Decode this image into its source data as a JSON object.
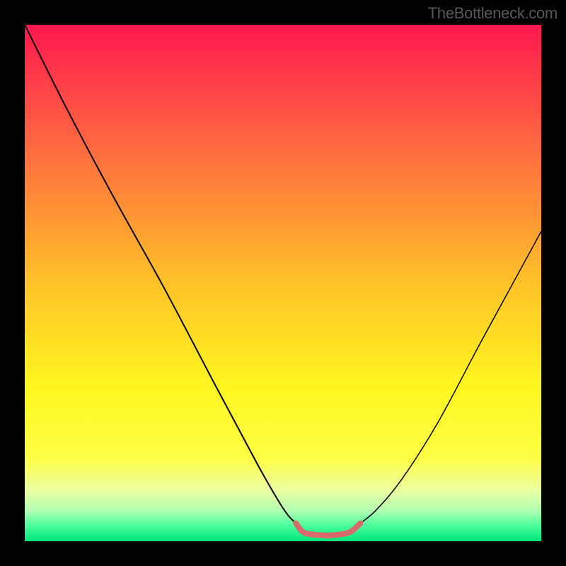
{
  "watermark": "TheBottleneck.com",
  "chart_data": {
    "type": "line",
    "title": "",
    "xlabel": "",
    "ylabel": "",
    "xlim": [
      0,
      100
    ],
    "ylim": [
      0,
      100
    ],
    "axes_visible": false,
    "grid": false,
    "background": {
      "type": "vertical-gradient",
      "stops": [
        {
          "offset": 0,
          "color": "#ff184f"
        },
        {
          "offset": 25,
          "color": "#ff6e3f"
        },
        {
          "offset": 50,
          "color": "#ffc229"
        },
        {
          "offset": 70,
          "color": "#fff61f"
        },
        {
          "offset": 84,
          "color": "#fdff45"
        },
        {
          "offset": 90,
          "color": "#ecffa0"
        },
        {
          "offset": 94,
          "color": "#b4ffb2"
        },
        {
          "offset": 97,
          "color": "#4aff9c"
        },
        {
          "offset": 100,
          "color": "#00e47a"
        }
      ]
    },
    "series": [
      {
        "name": "left-branch",
        "color": "#000000",
        "width": 2,
        "x": [
          0,
          8,
          17,
          27,
          37,
          45,
          49,
          51,
          52.5
        ],
        "y": [
          100,
          84,
          67,
          49,
          30,
          15,
          8,
          5,
          3.5
        ]
      },
      {
        "name": "right-branch",
        "color": "#000000",
        "width": 1.5,
        "x": [
          65,
          68,
          73,
          80,
          88,
          94,
          100
        ],
        "y": [
          3.5,
          6,
          12,
          23,
          38,
          49,
          60
        ]
      },
      {
        "name": "bottom-segment",
        "color": "#d96a6a",
        "width": 8,
        "linecap": "round",
        "x": [
          52.5,
          54,
          57,
          60,
          63,
          65
        ],
        "y": [
          3.5,
          1.7,
          1.2,
          1.2,
          1.8,
          3.5
        ]
      }
    ]
  }
}
